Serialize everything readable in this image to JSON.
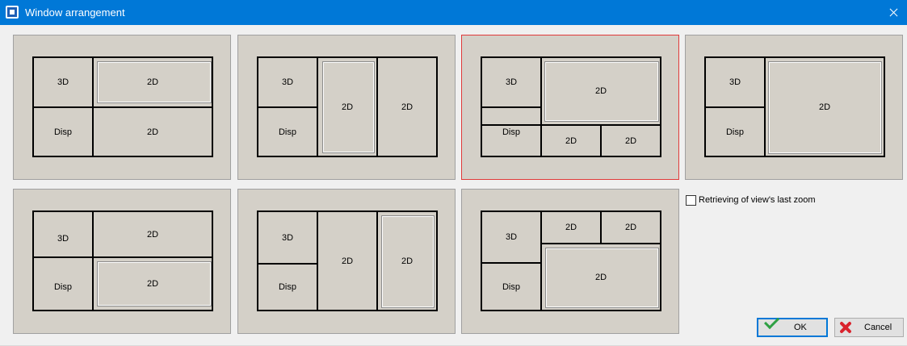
{
  "window": {
    "title": "Window arrangement"
  },
  "layouts": [
    {
      "id": "layout-1",
      "panes": [
        "3D",
        "2D",
        "Disp",
        "2D"
      ]
    },
    {
      "id": "layout-2",
      "panes": [
        "3D",
        "2D",
        "2D",
        "Disp"
      ]
    },
    {
      "id": "layout-3",
      "panes": [
        "3D",
        "2D",
        "Disp",
        "2D",
        "2D"
      ],
      "selected": true
    },
    {
      "id": "layout-4",
      "panes": [
        "3D",
        "2D",
        "Disp"
      ]
    },
    {
      "id": "layout-5",
      "panes": [
        "3D",
        "2D",
        "Disp",
        "2D"
      ]
    },
    {
      "id": "layout-6",
      "panes": [
        "3D",
        "2D",
        "2D",
        "Disp"
      ]
    },
    {
      "id": "layout-7",
      "panes": [
        "2D",
        "2D",
        "3D",
        "2D",
        "Disp"
      ]
    }
  ],
  "options": {
    "last_zoom_label": "Retrieving of view's last zoom",
    "last_zoom_checked": false
  },
  "buttons": {
    "ok_label": "OK",
    "cancel_label": "Cancel"
  },
  "icons": {
    "app": "app-window-icon",
    "ok": "green-check-icon",
    "cancel": "red-x-icon",
    "close": "close-icon"
  }
}
